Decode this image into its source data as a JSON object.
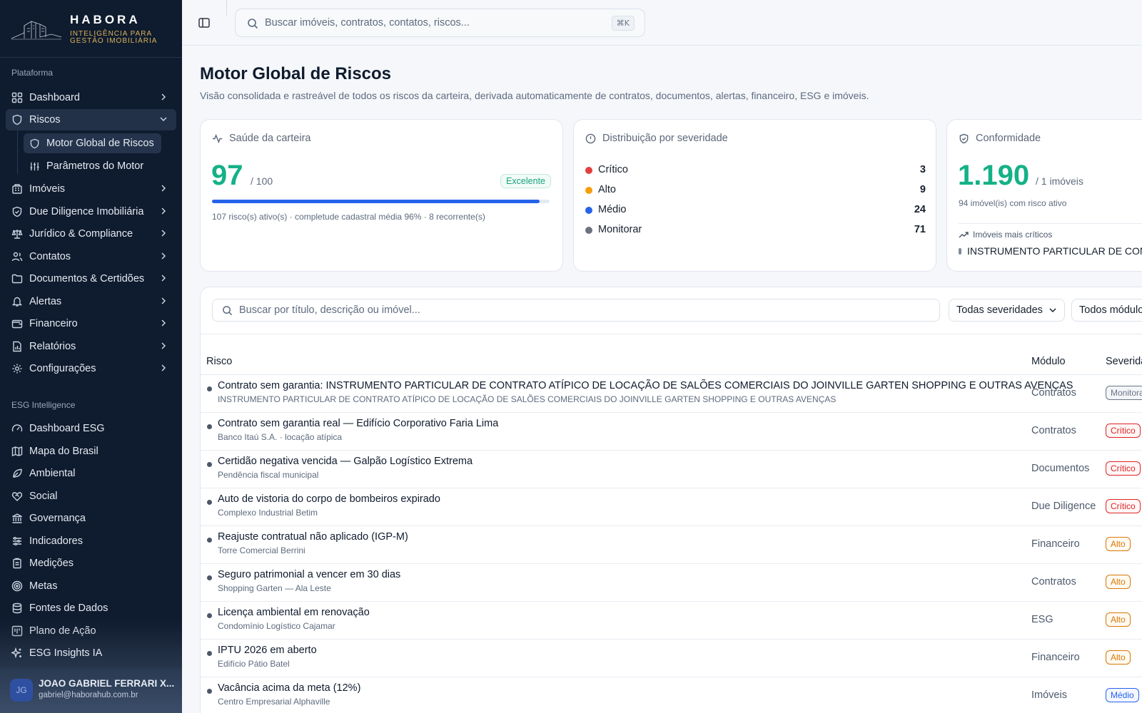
{
  "brand": {
    "name": "HABORA",
    "tagline_line1": "INTELIGÊNCIA PARA",
    "tagline_line2": "GESTÃO IMOBILIÁRIA"
  },
  "sidebar": {
    "platform_label": "Plataforma",
    "platform_items": [
      {
        "label": "Dashboard",
        "icon": "dashboard-icon"
      },
      {
        "label": "Riscos",
        "icon": "shield-icon"
      },
      {
        "label": "Imóveis",
        "icon": "building-icon"
      },
      {
        "label": "Due Diligence Imobiliária",
        "icon": "shield-check-icon"
      },
      {
        "label": "Jurídico & Compliance",
        "icon": "scale-icon"
      },
      {
        "label": "Contatos",
        "icon": "users-icon"
      },
      {
        "label": "Documentos & Certidões",
        "icon": "folder-icon"
      },
      {
        "label": "Alertas",
        "icon": "bell-icon"
      },
      {
        "label": "Financeiro",
        "icon": "wallet-icon"
      },
      {
        "label": "Relatórios",
        "icon": "file-chart-icon"
      },
      {
        "label": "Configurações",
        "icon": "gear-icon"
      }
    ],
    "risk_subitems": [
      {
        "label": "Motor Global de Riscos",
        "icon": "shield-icon"
      },
      {
        "label": "Parâmetros do Motor",
        "icon": "sliders-icon"
      }
    ],
    "esg_label": "ESG Intelligence",
    "esg_items": [
      {
        "label": "Dashboard ESG",
        "icon": "gauge-icon"
      },
      {
        "label": "Mapa do Brasil",
        "icon": "map-icon"
      },
      {
        "label": "Ambiental",
        "icon": "leaf-icon"
      },
      {
        "label": "Social",
        "icon": "heart-handshake-icon"
      },
      {
        "label": "Governança",
        "icon": "landmark-icon"
      },
      {
        "label": "Indicadores",
        "icon": "sliders-icon"
      },
      {
        "label": "Medições",
        "icon": "clipboard-icon"
      },
      {
        "label": "Metas",
        "icon": "target-icon"
      },
      {
        "label": "Fontes de Dados",
        "icon": "database-icon"
      },
      {
        "label": "Plano de Ação",
        "icon": "kanban-icon"
      },
      {
        "label": "ESG Insights IA",
        "icon": "sparkles-icon"
      }
    ],
    "user": {
      "initials": "JG",
      "name": "JOAO GABRIEL FERRARI X...",
      "email": "gabriel@haborahub.com.br"
    }
  },
  "topbar": {
    "search_placeholder": "Buscar imóveis, contratos, contatos, riscos...",
    "shortcut": "⌘K"
  },
  "page": {
    "title": "Motor Global de Riscos",
    "subtitle": "Visão consolidada e rastreável de todos os riscos da carteira, derivada automaticamente de contratos, documentos, alertas, financeiro, ESG e imóveis."
  },
  "health": {
    "title": "Saúde da carteira",
    "score": "97",
    "max": "/ 100",
    "status": "Excelente",
    "progress": 0.97,
    "footnote": "107 risco(s) ativo(s) · completude cadastral média 96% · 8 recorrente(s)"
  },
  "severity": {
    "title": "Distribuição por severidade",
    "items": [
      {
        "label": "Crítico",
        "count": "3",
        "color": "#e53e3e"
      },
      {
        "label": "Alto",
        "count": "9",
        "color": "#f59e0b"
      },
      {
        "label": "Médio",
        "count": "24",
        "color": "#2563eb"
      },
      {
        "label": "Monitorar",
        "count": "71",
        "color": "#6b7280"
      }
    ]
  },
  "compliance": {
    "title": "Conformidade",
    "value": "1.190",
    "unit": "/ 1 imóveis",
    "sub": "94 imóvel(is) com risco ativo",
    "critical_label": "Imóveis mais críticos",
    "critical_item": "INSTRUMENTO PARTICULAR DE CONT"
  },
  "table": {
    "search_placeholder": "Buscar por título, descrição ou imóvel...",
    "severity_filter": "Todas severidades",
    "module_filter": "Todos módulo",
    "columns": {
      "risk": "Risco",
      "module": "Módulo",
      "severity": "Severida"
    },
    "rows": [
      {
        "title": "Contrato sem garantia: INSTRUMENTO PARTICULAR DE CONTRATO ATÍPICO DE LOCAÇÃO DE SALÕES COMERCIAIS DO JOINVILLE GARTEN SHOPPING E OUTRAS AVENÇAS",
        "subtitle": "INSTRUMENTO PARTICULAR DE CONTRATO ATÍPICO DE LOCAÇÃO DE SALÕES COMERCIAIS DO JOINVILLE GARTEN SHOPPING E OUTRAS AVENÇAS",
        "module": "Contratos",
        "severity": "Monitorar",
        "sev_class": "sev-monitorar"
      },
      {
        "title": "Contrato sem garantia real — Edifício Corporativo Faria Lima",
        "subtitle": "Banco Itaú S.A. · locação atípica",
        "module": "Contratos",
        "severity": "Crítico",
        "sev_class": "sev-critico"
      },
      {
        "title": "Certidão negativa vencida — Galpão Logístico Extrema",
        "subtitle": "Pendência fiscal municipal",
        "module": "Documentos",
        "severity": "Crítico",
        "sev_class": "sev-critico"
      },
      {
        "title": "Auto de vistoria do corpo de bombeiros expirado",
        "subtitle": "Complexo Industrial Betim",
        "module": "Due Diligence",
        "severity": "Crítico",
        "sev_class": "sev-critico"
      },
      {
        "title": "Reajuste contratual não aplicado (IGP-M)",
        "subtitle": "Torre Comercial Berrini",
        "module": "Financeiro",
        "severity": "Alto",
        "sev_class": "sev-alto"
      },
      {
        "title": "Seguro patrimonial a vencer em 30 dias",
        "subtitle": "Shopping Garten — Ala Leste",
        "module": "Contratos",
        "severity": "Alto",
        "sev_class": "sev-alto"
      },
      {
        "title": "Licença ambiental em renovação",
        "subtitle": "Condomínio Logístico Cajamar",
        "module": "ESG",
        "severity": "Alto",
        "sev_class": "sev-alto"
      },
      {
        "title": "IPTU 2026 em aberto",
        "subtitle": "Edifício Pátio Batel",
        "module": "Financeiro",
        "severity": "Alto",
        "sev_class": "sev-alto"
      },
      {
        "title": "Vacância acima da meta (12%)",
        "subtitle": "Centro Empresarial Alphaville",
        "module": "Imóveis",
        "severity": "Médio",
        "sev_class": "sev-medio"
      }
    ]
  }
}
